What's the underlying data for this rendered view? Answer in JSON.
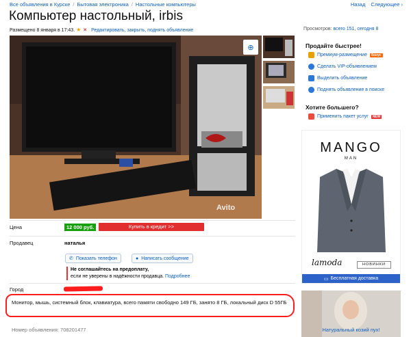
{
  "breadcrumbs": [
    "Все объявления в Курске",
    "Бытовая электроника",
    "Настольные компьютеры"
  ],
  "pager": {
    "back": "Назад",
    "next": "Следующее"
  },
  "title": "Компьютер настольный, irbis",
  "meta": {
    "posted": "Размещено 8 января в 17:43.",
    "actions": "Редактировать, закрыть, поднять объявление"
  },
  "views": {
    "label": "Просмотров:",
    "value": "всего 151, сегодня 8"
  },
  "photo": {
    "watermark": "Avito"
  },
  "sidebar": {
    "sell_faster": "Продайте быстрее!",
    "items": [
      {
        "label": "Премиум-размещение",
        "badge": "бонус",
        "color": "#e8a000"
      },
      {
        "label": "Сделать VIP-объявлением",
        "color": "#2b78d8"
      },
      {
        "label": "Выделить объявление",
        "color": "#2b78d8"
      },
      {
        "label": "Поднять объявление в поиске",
        "color": "#2b78d8"
      }
    ],
    "want_more": "Хотите большего?",
    "package": {
      "label": "Применить пакет услуг",
      "badge": "NEW"
    }
  },
  "ad": {
    "brand": "MANGO",
    "sub": "MAN",
    "partner": "lamoda",
    "button": "НОВИНКИ",
    "shipping": "Бесплатная доставка"
  },
  "ad2": {
    "caption": "Натуральный козий пух!"
  },
  "price": {
    "label": "Цена",
    "value": "12 000 руб.",
    "credit": "Купить в кредит  >>"
  },
  "seller": {
    "label": "Продавец",
    "name": "наталья",
    "phone_btn": "Показать телефон",
    "msg_btn": "Написать сообщение"
  },
  "warning": {
    "line1": "Не соглашайтесь на предоплату,",
    "line2": "если не уверены в надёжности продавца.",
    "more": "Подробнее"
  },
  "city": {
    "label": "Город"
  },
  "description": "Монитор, мышь, системный блок, клавиатура, всего памяти свободно 149 ГБ, занято 8 ГБ, локальный диск D 55ГБ",
  "ad_number": "Номер объявления: 708201477",
  "colors": {
    "link": "#0b5fbf",
    "price": "#18a10f",
    "credit": "#e12e2e",
    "annotation": "#ff1c1c"
  }
}
